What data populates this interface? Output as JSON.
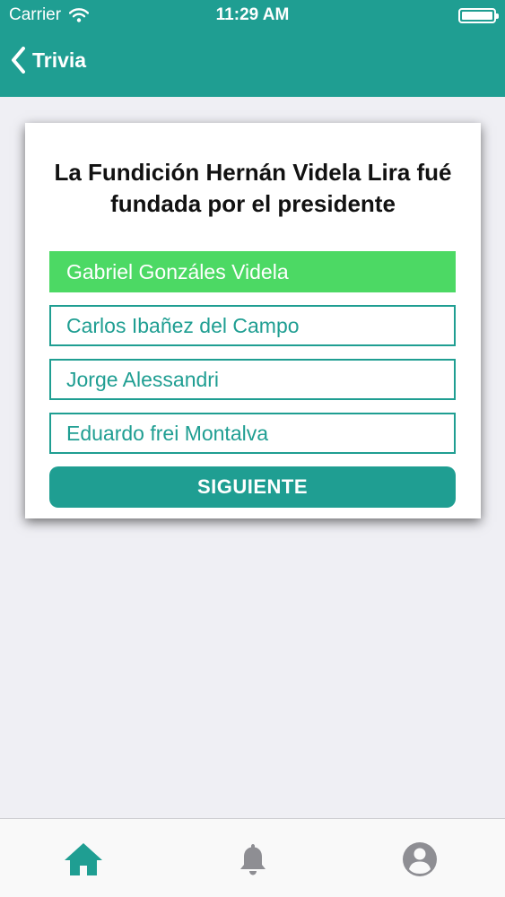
{
  "status_bar": {
    "carrier": "Carrier",
    "time": "11:29 AM",
    "battery_level": 1.0
  },
  "nav": {
    "back_label": "Trivia"
  },
  "quiz": {
    "question": "La Fundición Hernán Videla Lira fué fundada por el presidente",
    "options": [
      {
        "label": "Gabriel Gonzáles Videla",
        "selected": true
      },
      {
        "label": "Carlos Ibañez del Campo",
        "selected": false
      },
      {
        "label": "Jorge Alessandri",
        "selected": false
      },
      {
        "label": "Eduardo frei Montalva",
        "selected": false
      }
    ],
    "next_label": "SIGUIENTE"
  },
  "tab_bar": {
    "items": [
      {
        "icon": "home-icon",
        "active": true
      },
      {
        "icon": "bell-icon",
        "active": false
      },
      {
        "icon": "user-circle-icon",
        "active": false
      }
    ]
  },
  "colors": {
    "primary": "#1f9e92",
    "selected": "#4cd964",
    "inactive_icon": "#8e8e93"
  }
}
